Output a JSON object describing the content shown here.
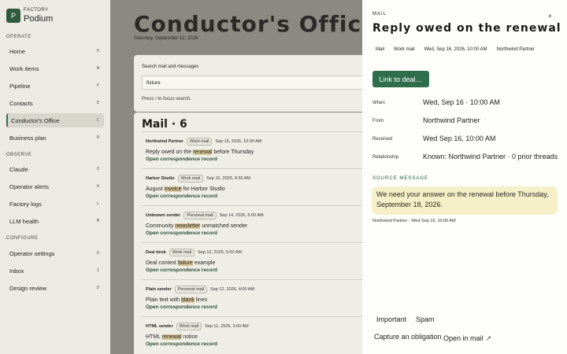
{
  "brand": {
    "logo": "P",
    "kicker": "FACTORY",
    "name": "Podium"
  },
  "sidebar": {
    "sections": [
      {
        "label": "OPERATE",
        "items": [
          {
            "label": "Home",
            "key": "H"
          },
          {
            "label": "Work items",
            "key": "W"
          },
          {
            "label": "Pipeline",
            "key": "P"
          },
          {
            "label": "Contacts",
            "key": "E"
          },
          {
            "label": "Conductor's Office",
            "key": "C",
            "active": true
          },
          {
            "label": "Business plan",
            "key": "B"
          }
        ]
      },
      {
        "label": "OBSERVE",
        "items": [
          {
            "label": "Claude",
            "key": "Q"
          },
          {
            "label": "Operator alerts",
            "key": "A"
          },
          {
            "label": "Factory logs",
            "key": "L"
          },
          {
            "label": "LLM health",
            "key": "M"
          }
        ]
      },
      {
        "label": "CONFIGURE",
        "items": [
          {
            "label": "Operator settings",
            "key": "O"
          },
          {
            "label": "Inbox",
            "key": "I"
          },
          {
            "label": "Design review",
            "key": "D"
          }
        ]
      }
    ]
  },
  "main": {
    "title": "Conductor's Office",
    "date": "Saturday, September 12, 2026",
    "search": {
      "label": "Search mail and messages",
      "value": "fixture",
      "hint": "Press / to focus search."
    },
    "mail_heading": "Mail · 6",
    "rows": [
      {
        "sender": "Northwind Partner",
        "tag": "Work mail",
        "date": "Sep 16, 2026, 10:00 AM",
        "pre": "Reply owed on the ",
        "mark": "renewal",
        "post": " before Thursday",
        "link": "Open correspondence record"
      },
      {
        "sender": "Harbor Studio",
        "tag": "Work mail",
        "date": "Sep 15, 2026, 9:30 AM",
        "pre": "August ",
        "mark": "invoice",
        "post": " for Harbor Studio",
        "link": "Open correspondence record"
      },
      {
        "sender": "Unknown sender",
        "tag": "Personal mail",
        "date": "Sep 14, 2026, 6:00 AM",
        "pre": "Community ",
        "mark": "newsletter",
        "post": " unmatched sender",
        "link": "Open correspondence record"
      },
      {
        "sender": "Deal desk",
        "tag": "Work mail",
        "date": "Sep 13, 2026, 5:00 AM",
        "pre": "Deal context ",
        "mark": "failure",
        "post": " example",
        "link": "Open correspondence record"
      },
      {
        "sender": "Plain sender",
        "tag": "Personal mail",
        "date": "Sep 12, 2026, 4:00 AM",
        "pre": "Plain text with ",
        "mark": "blank",
        "post": " lines",
        "link": "Open correspondence record"
      },
      {
        "sender": "HTML sender",
        "tag": "Work mail",
        "date": "Sep 11, 2026, 3:00 AM",
        "pre": "HTML ",
        "mark": "renewal",
        "post": " notice",
        "link": "Open correspondence record"
      }
    ]
  },
  "panel": {
    "kicker": "MAIL",
    "close": "×",
    "title": "Reply owed on the renewal",
    "chips": [
      "Mail",
      "Work mail",
      "Wed, Sep 16, 2026, 10:00 AM",
      "Northwind Partner"
    ],
    "cta": "Link to deal…",
    "fields": [
      {
        "label": "When",
        "value": "Wed, Sep 16 · 10:00 AM"
      },
      {
        "label": "From",
        "value": "Northwind Partner"
      },
      {
        "label": "Received",
        "value": "Wed Sep 16, 10:00 AM"
      },
      {
        "label": "Relationship",
        "value": "Known: Northwind Partner · 0 prior threads"
      }
    ],
    "source_label": "SOURCE MESSAGE",
    "source_text": "We need your answer on the renewal before Thursday, September 18, 2026.",
    "source_meta": "Northwind Partner · Wed Sep 16, 10:00 AM",
    "actions": {
      "important": "Important",
      "spam": "Spam",
      "capture": "Capture an obligation",
      "open": "Open in mail",
      "open_icon": "↗"
    }
  },
  "colors": {
    "accent": "#2f6e4c",
    "highlight": "#f6f0c8",
    "sidebar": "#ecebe3"
  }
}
